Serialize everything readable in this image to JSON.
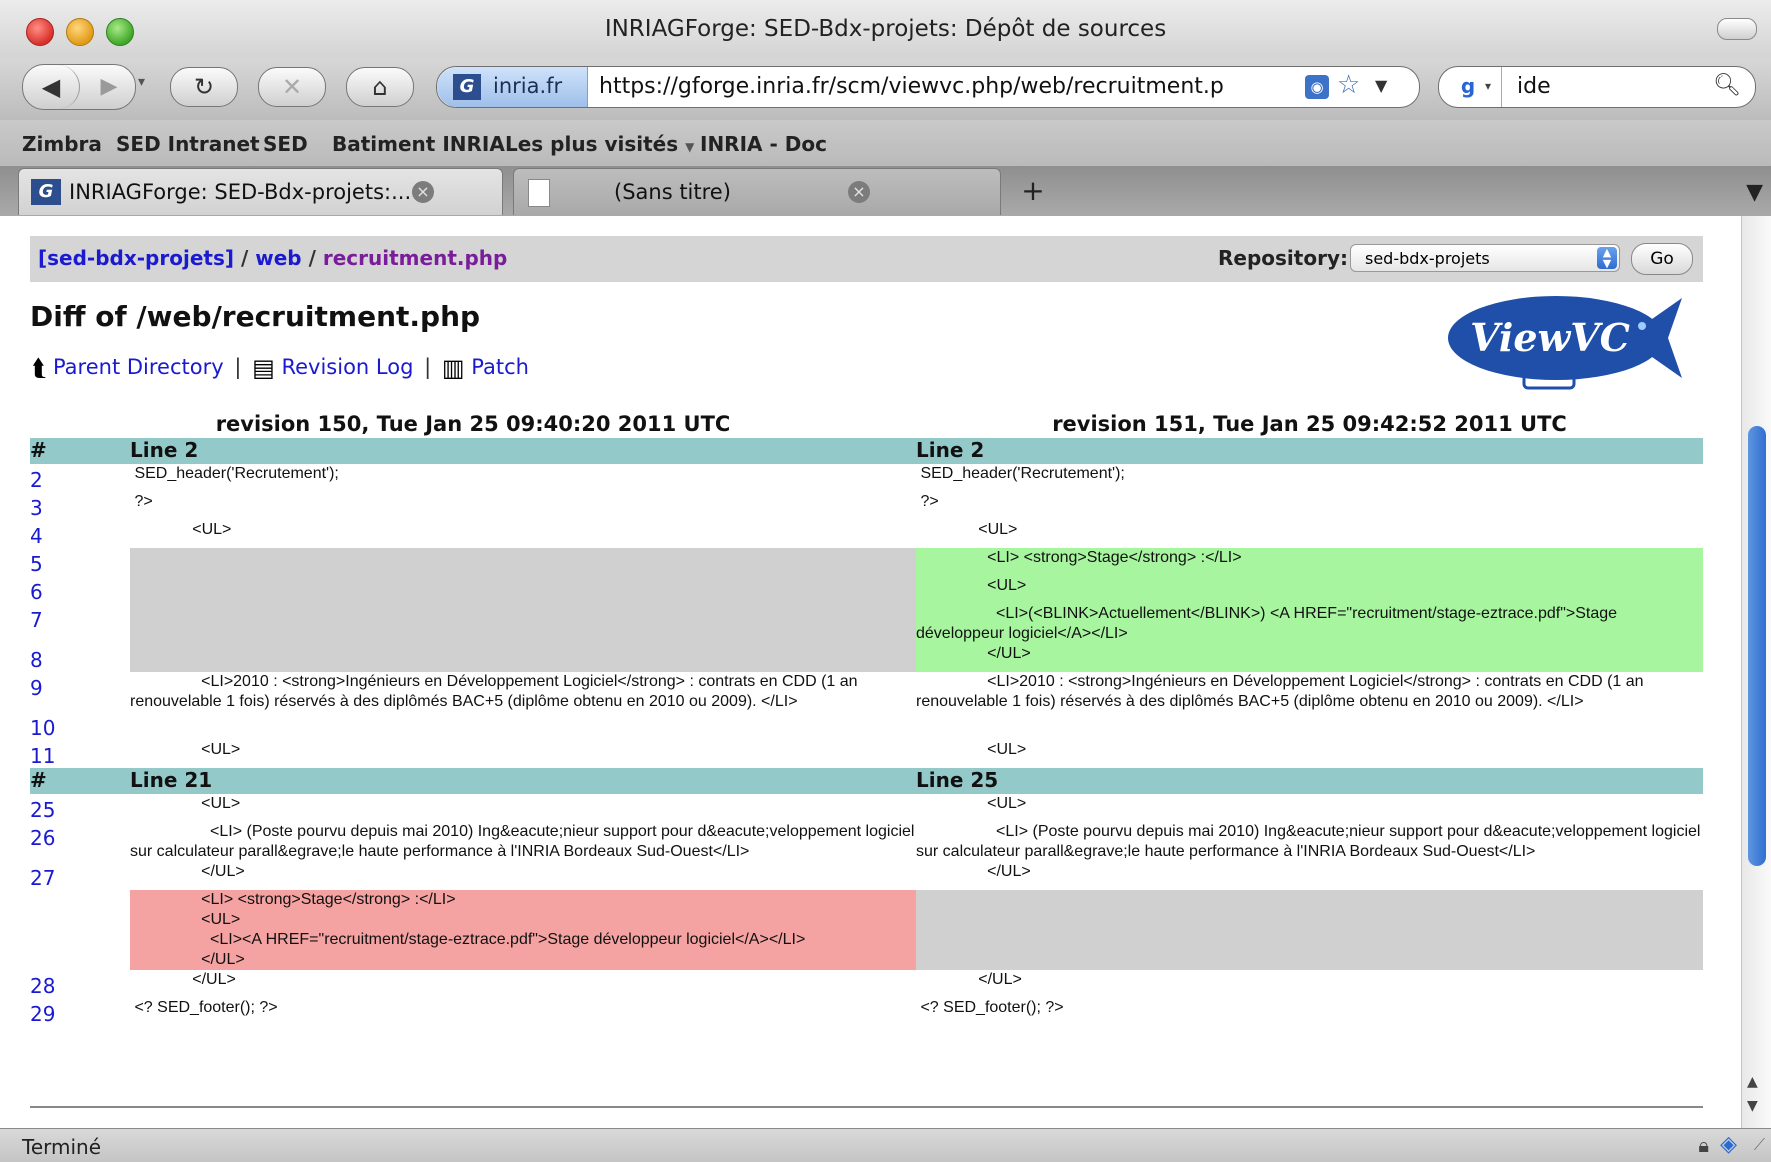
{
  "window": {
    "title": "INRIAGForge: SED-Bdx-projets: Dépôt de sources"
  },
  "toolbar": {
    "site_identity": "inria.fr",
    "url": "https://gforge.inria.fr/scm/viewvc.php/web/recruitment.p",
    "search_value": "ide",
    "search_engine_icon": "google-icon"
  },
  "bookmarks": [
    "Zimbra",
    "SED Intranet",
    "SED",
    "Batiment INRIA",
    "Les plus visités",
    "INRIA - Doc"
  ],
  "tabs": [
    {
      "label": "INRIAGForge: SED-Bdx-projets:...",
      "active": true
    },
    {
      "label": "(Sans titre)",
      "active": false
    }
  ],
  "page": {
    "breadcrumb": {
      "root": "[sed-bdx-projets]",
      "sep": "/",
      "dir": "web",
      "file": "recruitment.php"
    },
    "repository_label": "Repository:",
    "repository_value": "sed-bdx-projets",
    "go_label": "Go",
    "title": "Diff of /web/recruitment.php",
    "logo_text": "ViewVC",
    "actions": {
      "parent": "Parent Directory",
      "sep": "|",
      "log": "Revision Log",
      "patch": "Patch"
    },
    "diff": {
      "left_rev": "revision 150, Tue Jan 25 09:40:20 2011 UTC",
      "right_rev": "revision 151, Tue Jan 25 09:42:52 2011 UTC",
      "hash": "#",
      "sec1_left": "Line 2",
      "sec1_right": "Line 2",
      "sec2_left": "Line 21",
      "sec2_right": "Line 25",
      "ln": [
        "2",
        "3",
        "4",
        "5",
        "6",
        "7",
        "8",
        "9",
        "10",
        "11",
        "25",
        "26",
        "27",
        "28",
        "29"
      ],
      "l2": " SED_header('Recrutement');",
      "l3": " ?>",
      "l4": "              <UL>",
      "a5": "                <LI> <strong>Stage</strong> :</LI>",
      "a6": "                <UL>",
      "a7": "                  <LI>(<BLINK>Actuellement</BLINK>) <A HREF=\"recruitment/stage-eztrace.pdf\">Stage développeur logiciel</A></LI>",
      "a8": "                </UL>",
      "l9": "                <LI>2010 : <strong>Ingénieurs en Développement Logiciel</strong> : contrats en CDD (1 an renouvelable 1 fois) réservés à des diplômés BAC+5 (diplôme obtenu en 2010 ou 2009). </LI>",
      "l10": "",
      "l11": "                <UL>",
      "l25": "                <UL>",
      "l26": "                  <LI> (Poste pourvu depuis mai 2010) Ing&eacute;nieur support pour d&eacute;veloppement logiciel sur calculateur parall&egrave;le haute performance à l'INRIA Bordeaux Sud-Ouest</LI>",
      "l27": "                </UL>",
      "r1": "                <LI> <strong>Stage</strong> :</LI>",
      "r2": "                <UL>",
      "r3": "                  <LI><A HREF=\"recruitment/stage-eztrace.pdf\">Stage développeur logiciel</A></LI>",
      "r4": "                </UL>",
      "l28": "              </UL>",
      "l29": " <? SED_footer(); ?>"
    }
  },
  "status": {
    "text": "Terminé"
  }
}
